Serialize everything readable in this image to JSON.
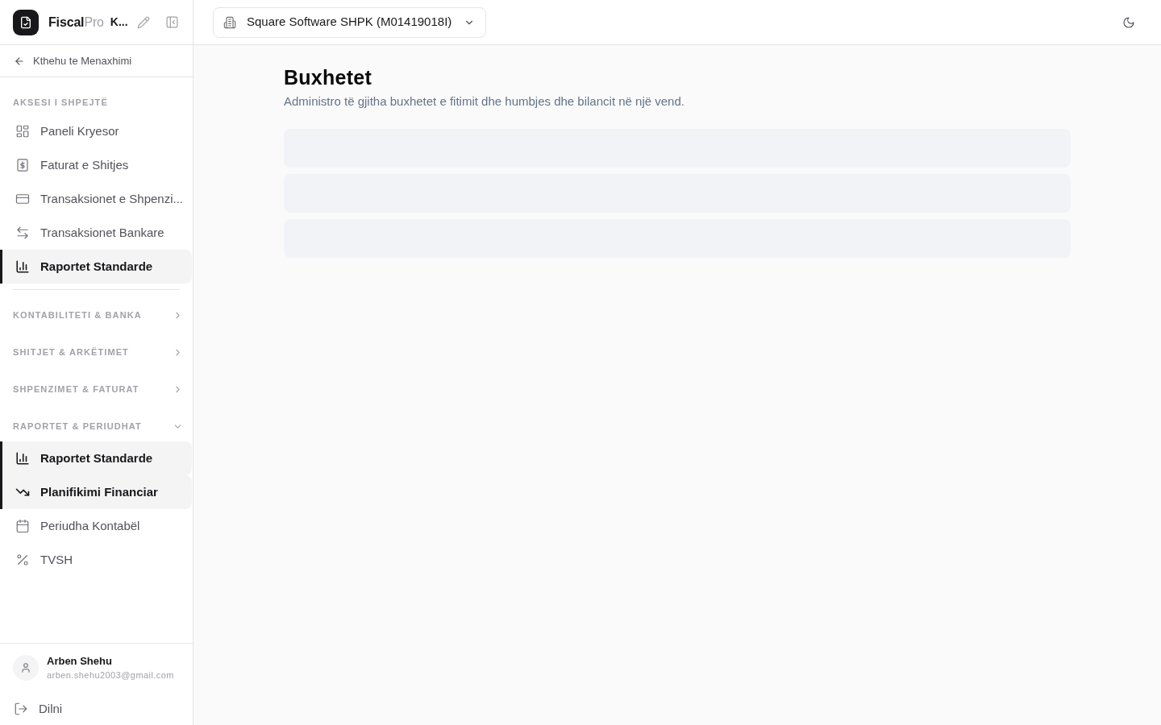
{
  "brand": {
    "name": "Fiscal",
    "suffix": "Pro",
    "workspace": "K..."
  },
  "back_link": {
    "label": "Kthehu te Menaxhimi"
  },
  "sidebar": {
    "sections": [
      {
        "title": "AKSESI I SHPEJTË",
        "kind": "static",
        "items": [
          {
            "label": "Paneli Kryesor",
            "selected": false
          },
          {
            "label": "Faturat e Shitjes",
            "selected": false
          },
          {
            "label": "Transaksionet e Shpenzi...",
            "selected": false
          },
          {
            "label": "Transaksionet Bankare",
            "selected": false
          },
          {
            "label": "Raportet Standarde",
            "selected": true
          }
        ]
      },
      {
        "title": "KONTABILITETI & BANKA",
        "kind": "collapsible",
        "expanded": false
      },
      {
        "title": "SHITJET & ARKËTIMET",
        "kind": "collapsible",
        "expanded": false
      },
      {
        "title": "SHPENZIMET & FATURAT",
        "kind": "collapsible",
        "expanded": false
      },
      {
        "title": "RAPORTET & PERIUDHAT",
        "kind": "collapsible",
        "expanded": true,
        "items": [
          {
            "label": "Raportet Standarde",
            "selected": true
          },
          {
            "label": "Planifikimi Financiar",
            "selected": true
          },
          {
            "label": "Periudha Kontabël",
            "selected": false
          },
          {
            "label": "TVSH",
            "selected": false
          }
        ]
      }
    ]
  },
  "user": {
    "name": "Arben Shehu",
    "email": "arben.shehu2003@gmail.com"
  },
  "logout": {
    "label": "Dilni"
  },
  "header": {
    "company_selector": {
      "value": "Square Software SHPK (M01419018I)"
    }
  },
  "page": {
    "title": "Buxhetet",
    "subtitle": "Administro të gjitha buxhetet e fitimit dhe humbjes dhe bilancit në një vend.",
    "loading": true
  }
}
